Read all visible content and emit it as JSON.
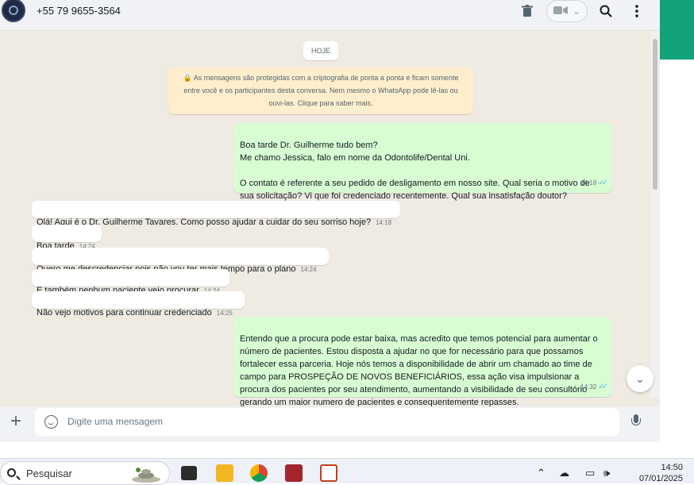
{
  "header": {
    "contact_name": "+55 79 9655-3564",
    "icons": [
      "trash-icon",
      "video-camera-icon",
      "chevron-down-icon",
      "search-icon",
      "more-vertical-icon"
    ]
  },
  "chat": {
    "date_chip": "HOJE",
    "encryption_notice": "🔒 As mensagens são protegidas com a criptografia de ponta a ponta e ficam somente entre você e os participantes desta conversa. Nem mesmo o WhatsApp pode lê-las ou ouvi-las. Clique para saber mais.",
    "messages": [
      {
        "direction": "out",
        "text": "Boa tarde Dr. Guilherme tudo bem?\nMe chamo Jessica, falo em nome da Odontolife/Dental Uni.\n\nO contato é referente a seu pedido de desligamento em nosso site. Qual seria o motivo de sua solicitação? Vi que foi credenciado recentemente. Qual sua insatisfação doutor?",
        "time": "14:18",
        "status": "read"
      },
      {
        "direction": "in",
        "text": "Olá! Aqui é o Dr. Guilherme Tavares. Como posso ajudar a cuidar do seu sorriso hoje?",
        "time": "14:18"
      },
      {
        "direction": "in",
        "text": "Boa tarde",
        "time": "14:24"
      },
      {
        "direction": "in",
        "text": "Quero me descredenciar pois não vou ter mais tempo para o plano",
        "time": "14:24"
      },
      {
        "direction": "in",
        "text": "E também nenhum paciente veio procurar",
        "time": "14:24"
      },
      {
        "direction": "in",
        "text": "Não vejo motivos para continuar credenciado",
        "time": "14:25"
      },
      {
        "direction": "out",
        "text": "Entendo que a procura pode estar baixa, mas acredito que temos potencial para aumentar o número de pacientes. Estou disposta a ajudar no que for necessário para que possamos fortalecer essa parceria. Hoje nós temos a disponibilidade de abrir um chamado ao time de campo para PROSPEÇÃO DE NOVOS  BENEFICIÁRIOS, essa ação visa impulsionar a procura dos pacientes por seu atendimento, aumentando a visibilidade de seu consultório gerando um maior numero de pacientes e consequentemente repasses.",
        "time": "14:32",
        "status": "read"
      }
    ]
  },
  "composer": {
    "placeholder": "Digite uma mensagem"
  },
  "taskbar": {
    "search_placeholder": "Pesquisar",
    "clock_time": "14:50",
    "clock_date": "07/01/2025"
  },
  "colors": {
    "chat_bg": "#efeae2",
    "outgoing_bubble": "#d9fdd3",
    "incoming_bubble": "#ffffff",
    "notice_bg": "#ffeecd",
    "read_ticks": "#53bdeb",
    "side_accent": "#12a37a"
  }
}
